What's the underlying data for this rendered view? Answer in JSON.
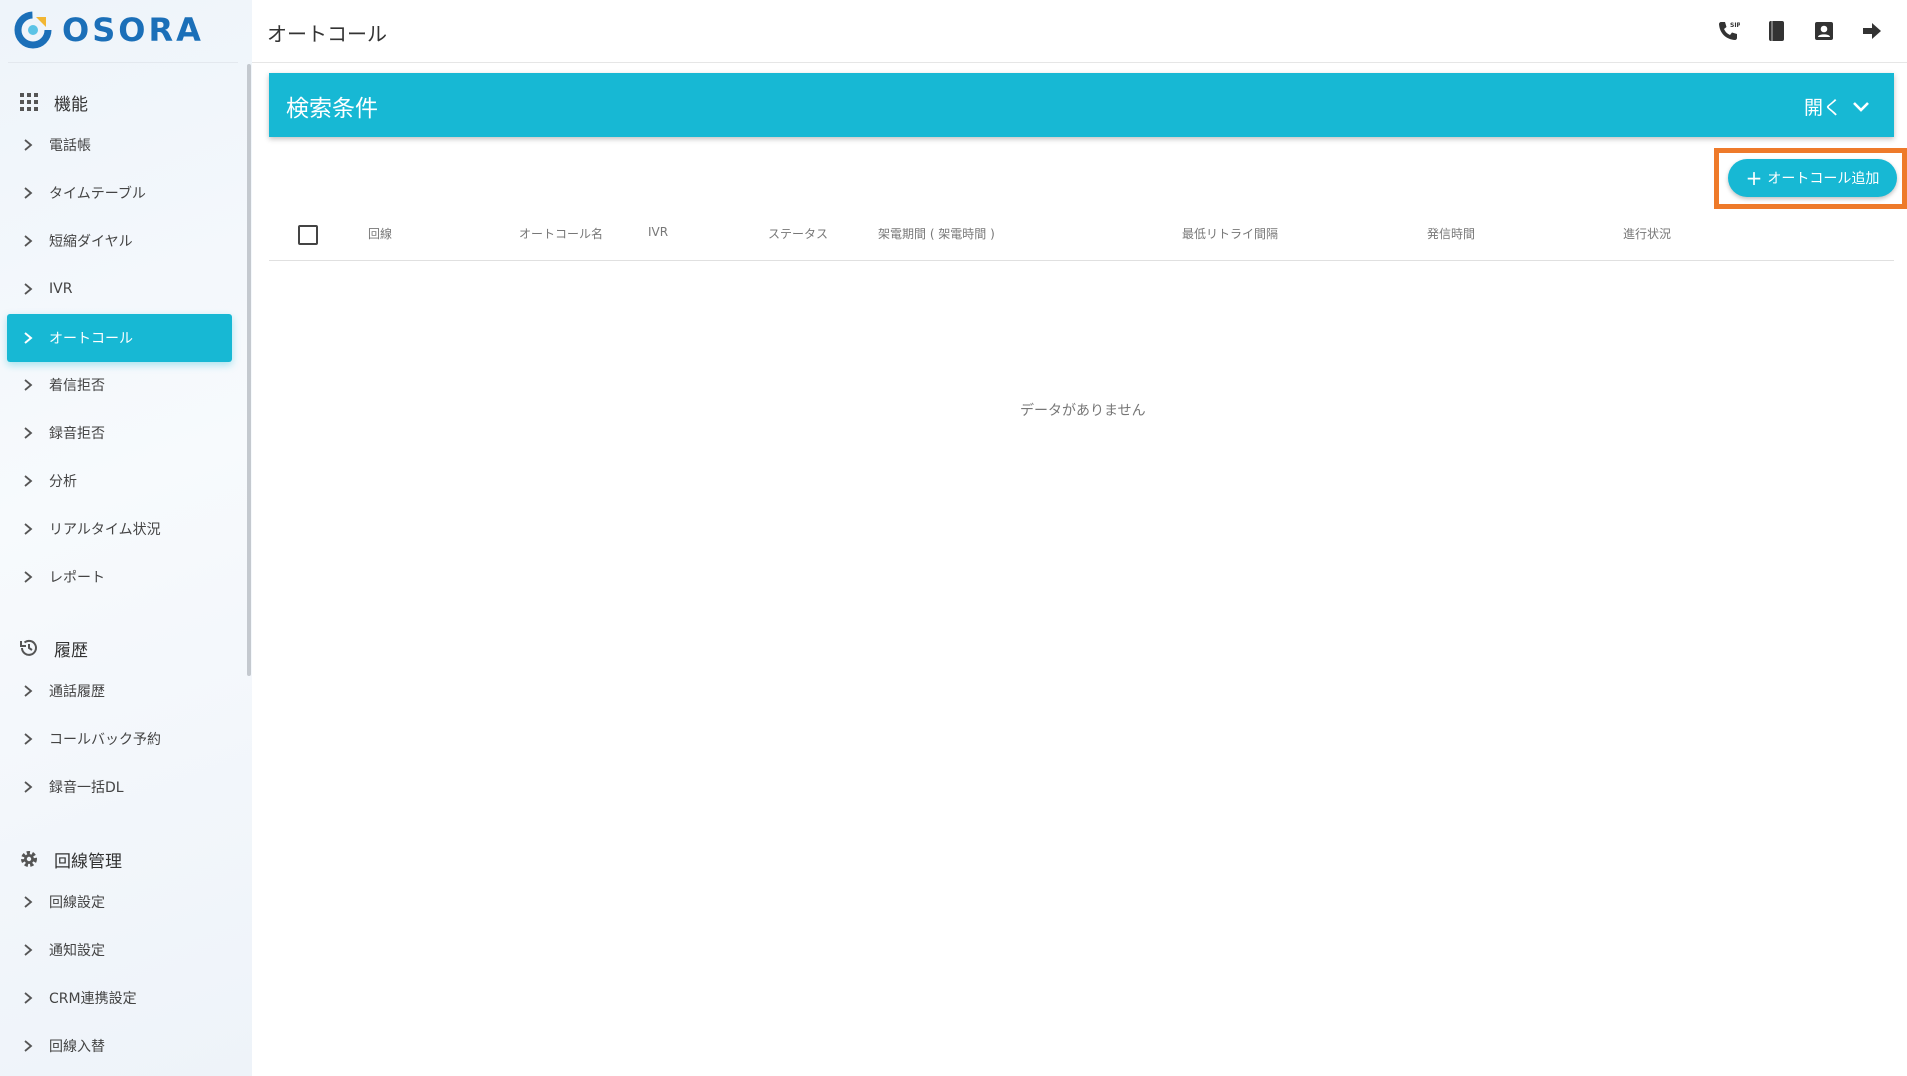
{
  "app": {
    "logo_text": "OSORA",
    "brand_color": "#1b6fb8",
    "accent_color": "#17b8d4",
    "highlight_color": "#ee7a2a"
  },
  "header": {
    "title": "オートコール",
    "icons": [
      "sip-phone-icon",
      "book-icon",
      "contact-icon",
      "logout-arrow-icon"
    ]
  },
  "sidebar": {
    "sections": [
      {
        "label": "機能",
        "icon": "grid-icon"
      },
      {
        "label": "履歴",
        "icon": "history-icon"
      },
      {
        "label": "回線管理",
        "icon": "gear-icon"
      }
    ],
    "functions": [
      "電話帳",
      "タイムテーブル",
      "短縮ダイヤル",
      "IVR",
      "オートコール",
      "着信拒否",
      "録音拒否",
      "分析",
      "リアルタイム状況",
      "レポート"
    ],
    "history": [
      "通話履歴",
      "コールバック予約",
      "録音一括DL"
    ],
    "line_management": [
      "回線設定",
      "通知設定",
      "CRM連携設定",
      "回線入替"
    ],
    "active_item": "オートコール"
  },
  "search": {
    "title": "検索条件",
    "toggle_label": "開く"
  },
  "actions": {
    "add_label": "オートコール追加"
  },
  "table": {
    "columns": [
      "回線",
      "オートコール名",
      "IVR",
      "ステータス",
      "架電期間 ( 架電時間 )",
      "最低リトライ間隔",
      "発信時間",
      "進行状況"
    ],
    "rows": [],
    "empty_message": "データがありません"
  }
}
